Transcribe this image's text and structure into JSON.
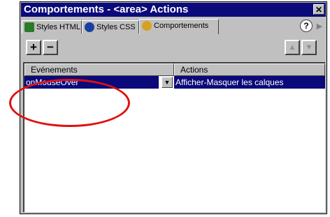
{
  "window": {
    "title": "Comportements - <area> Actions",
    "close_icon": "close-icon"
  },
  "tabs": [
    {
      "label": "Styles HTML",
      "icon": "styles-html-icon"
    },
    {
      "label": "Styles CSS",
      "icon": "styles-css-icon"
    },
    {
      "label": "Comportements",
      "icon": "behaviors-icon",
      "active": true
    }
  ],
  "help": {
    "label": "?"
  },
  "toolbar": {
    "add_label": "+",
    "remove_label": "−",
    "move_up_label": "▲",
    "move_down_label": "▼"
  },
  "list": {
    "headers": {
      "events": "Evénements",
      "actions": "Actions"
    },
    "rows": [
      {
        "event": "onMouseOver",
        "action": "Afficher-Masquer les calques",
        "selected": true
      }
    ]
  },
  "colors": {
    "titlebar": "#0a0a7a",
    "panel": "#c0c0c0",
    "selection": "#0a0a7a",
    "annotation": "#e01010"
  }
}
